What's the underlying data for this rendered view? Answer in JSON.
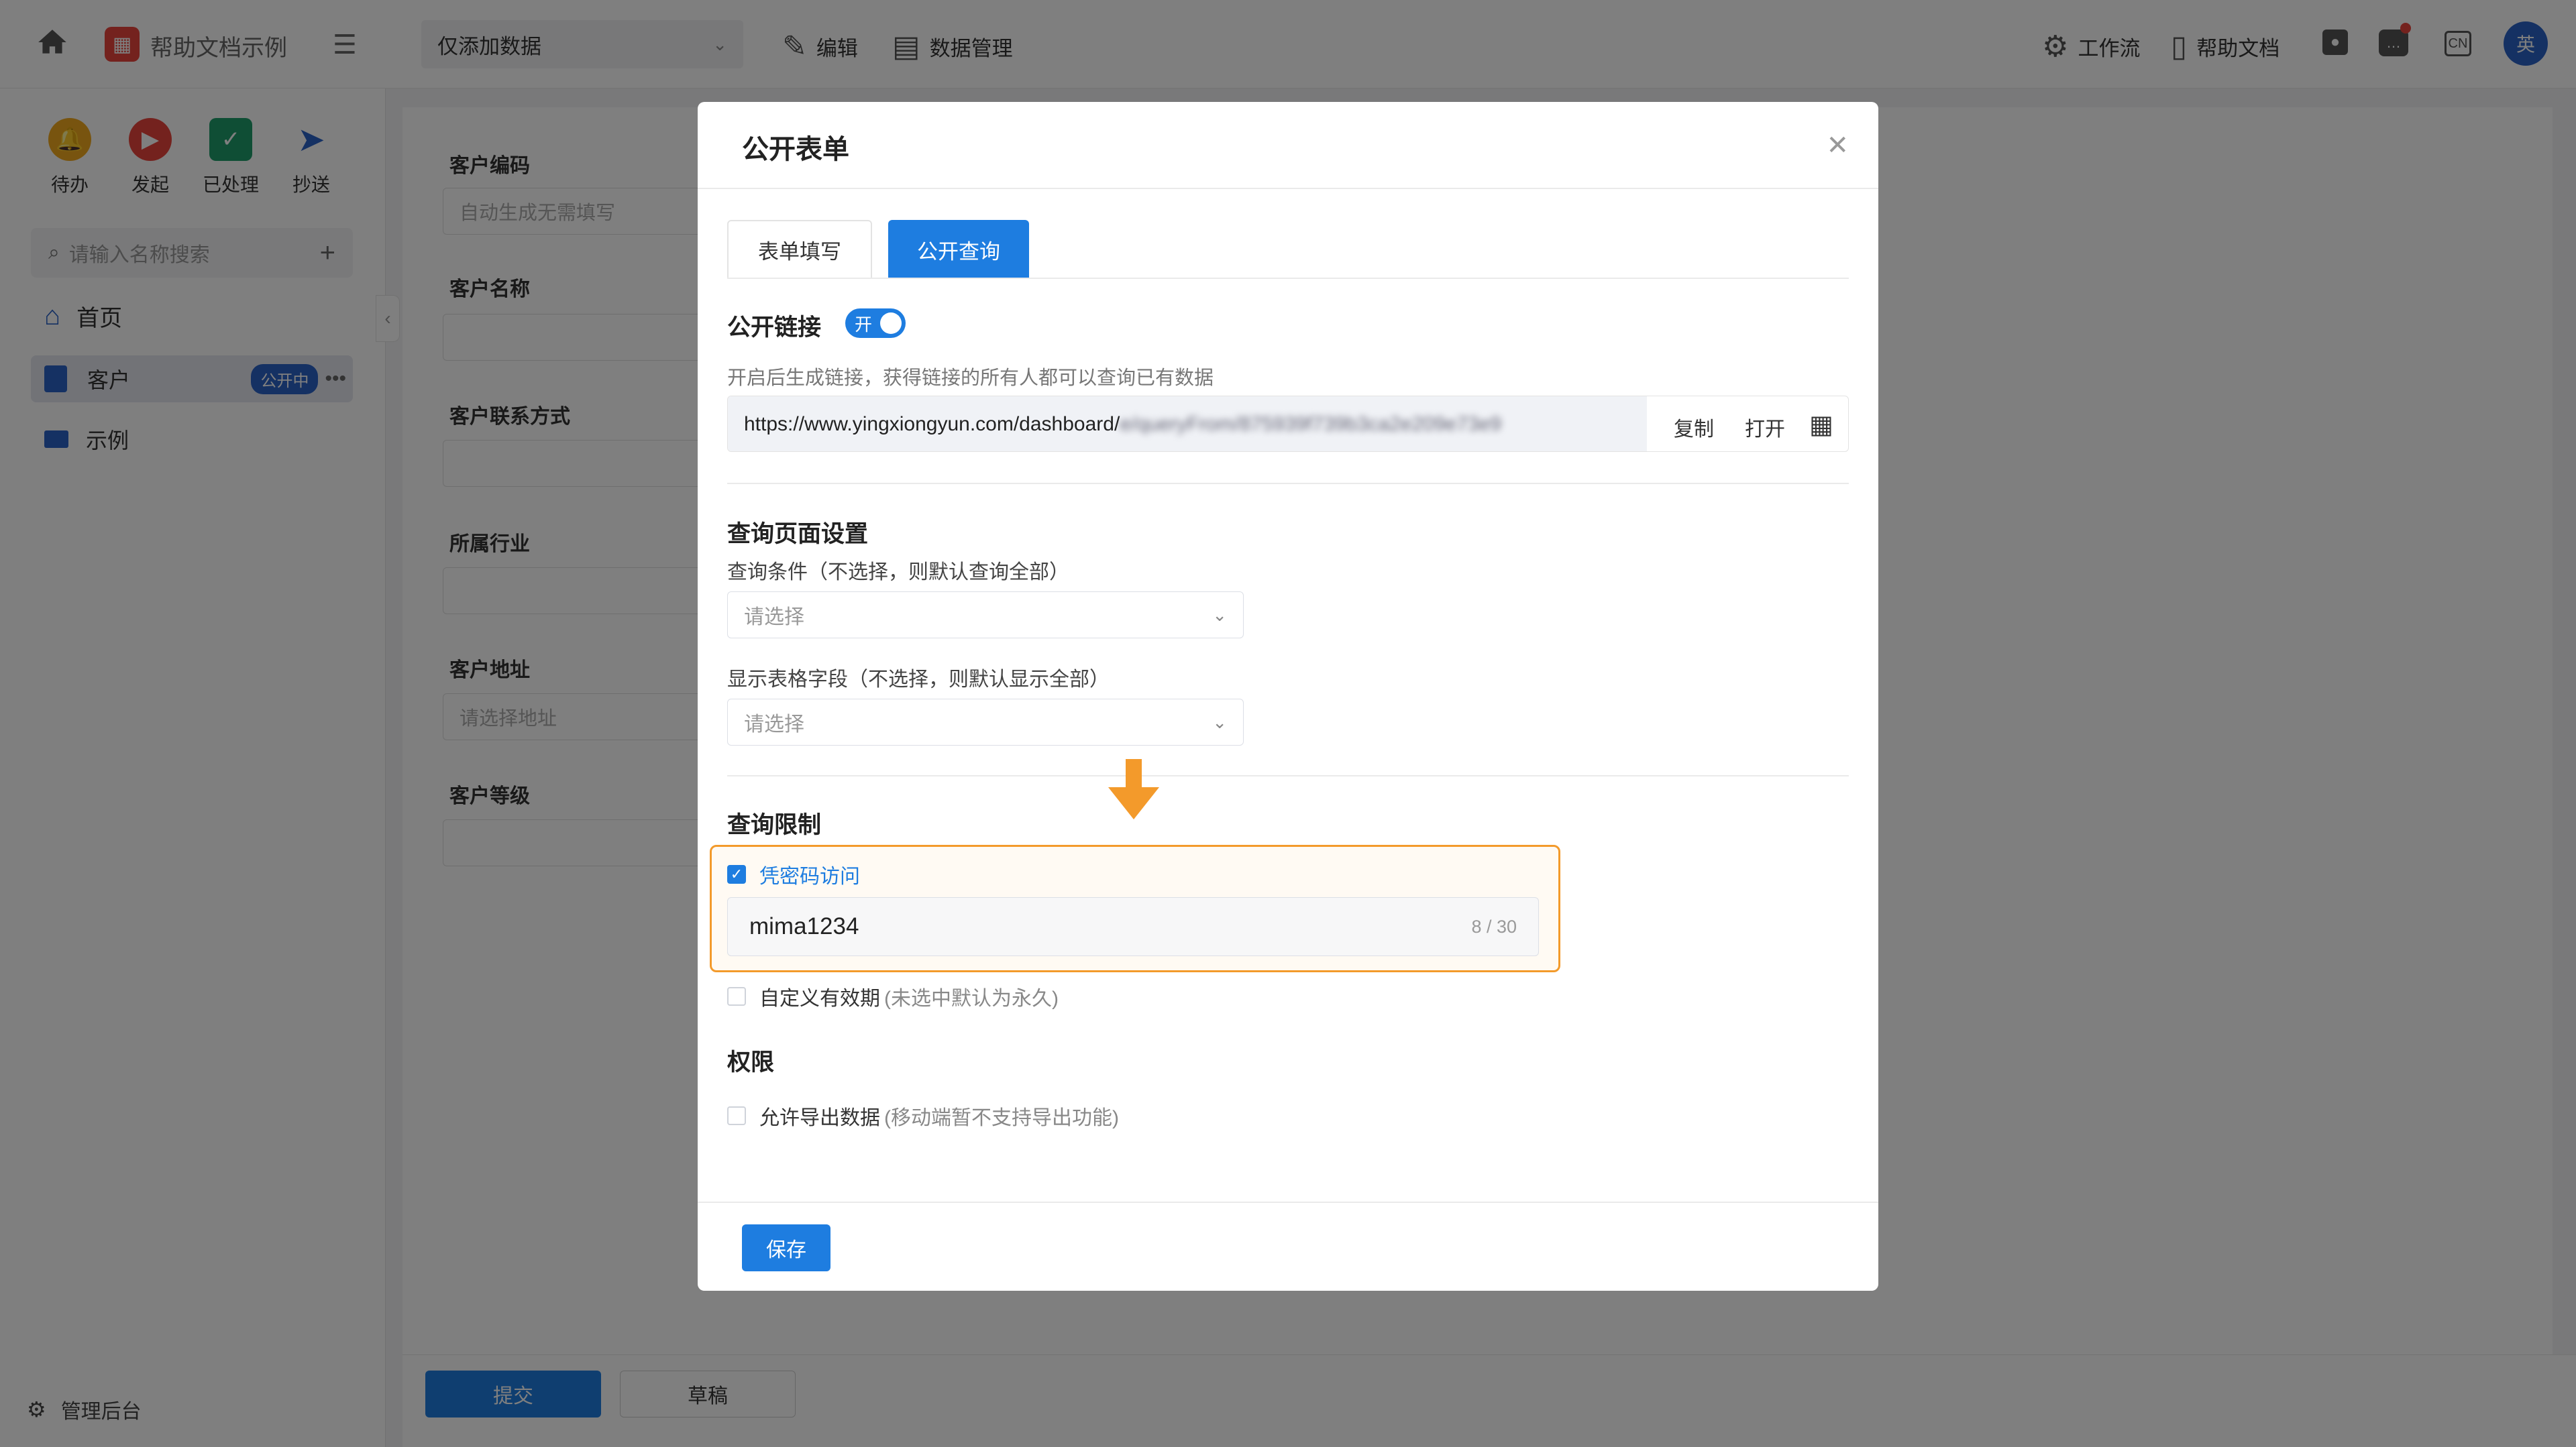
{
  "topbar": {
    "app_title": "帮助文档示例",
    "mode_select": "仅添加数据",
    "edit": "编辑",
    "data_mgmt": "数据管理",
    "workflow": "工作流",
    "help_doc": "帮助文档",
    "lang": "CN",
    "avatar": "英"
  },
  "sidebar": {
    "quick_actions": [
      {
        "label": "待办",
        "icon": "bell-icon",
        "color": "#f0a81e"
      },
      {
        "label": "发起",
        "icon": "play-icon",
        "color": "#e8453c"
      },
      {
        "label": "已处理",
        "icon": "done-icon",
        "color": "#1f9d6a"
      },
      {
        "label": "抄送",
        "icon": "send-icon",
        "color": "#2b62c6"
      }
    ],
    "search_placeholder": "请输入名称搜索",
    "home": "首页",
    "items": [
      {
        "label": "客户",
        "badge": "公开中"
      },
      {
        "label": "示例"
      }
    ],
    "admin": "管理后台"
  },
  "form": {
    "fields": [
      {
        "label": "客户编码",
        "placeholder": "自动生成无需填写"
      },
      {
        "label": "客户名称",
        "placeholder": ""
      },
      {
        "label": "客户联系方式",
        "placeholder": ""
      },
      {
        "label": "所属行业",
        "placeholder": ""
      },
      {
        "label": "客户地址",
        "placeholder": "请选择地址"
      },
      {
        "label": "客户等级",
        "placeholder": ""
      }
    ],
    "submit": "提交",
    "draft": "草稿"
  },
  "modal": {
    "title": "公开表单",
    "tabs": [
      "表单填写",
      "公开查询"
    ],
    "public_link_label": "公开链接",
    "toggle_on": "开",
    "link_desc": "开启后生成链接，获得链接的所有人都可以查询已有数据",
    "link_url": "https://www.yingxiongyun.com/dashboard/",
    "link_blurred": "e/queryFrom/875939f739b3ca2e209e73e9",
    "copy": "复制",
    "open": "打开",
    "query_settings_title": "查询页面设置",
    "query_condition_label": "查询条件（不选择，则默认查询全部）",
    "query_condition_placeholder": "请选择",
    "display_fields_label": "显示表格字段（不选择，则默认显示全部）",
    "display_fields_placeholder": "请选择",
    "query_limit_title": "查询限制",
    "password_access": "凭密码访问",
    "password_value": "mima1234",
    "password_count": "8 / 30",
    "custom_validity": "自定义有效期",
    "custom_validity_hint": "(未选中默认为永久)",
    "permissions_title": "权限",
    "allow_export": "允许导出数据",
    "allow_export_hint": "(移动端暂不支持导出功能)",
    "save": "保存"
  },
  "colors": {
    "primary": "#1e7de0",
    "highlight": "#f39a2b"
  }
}
